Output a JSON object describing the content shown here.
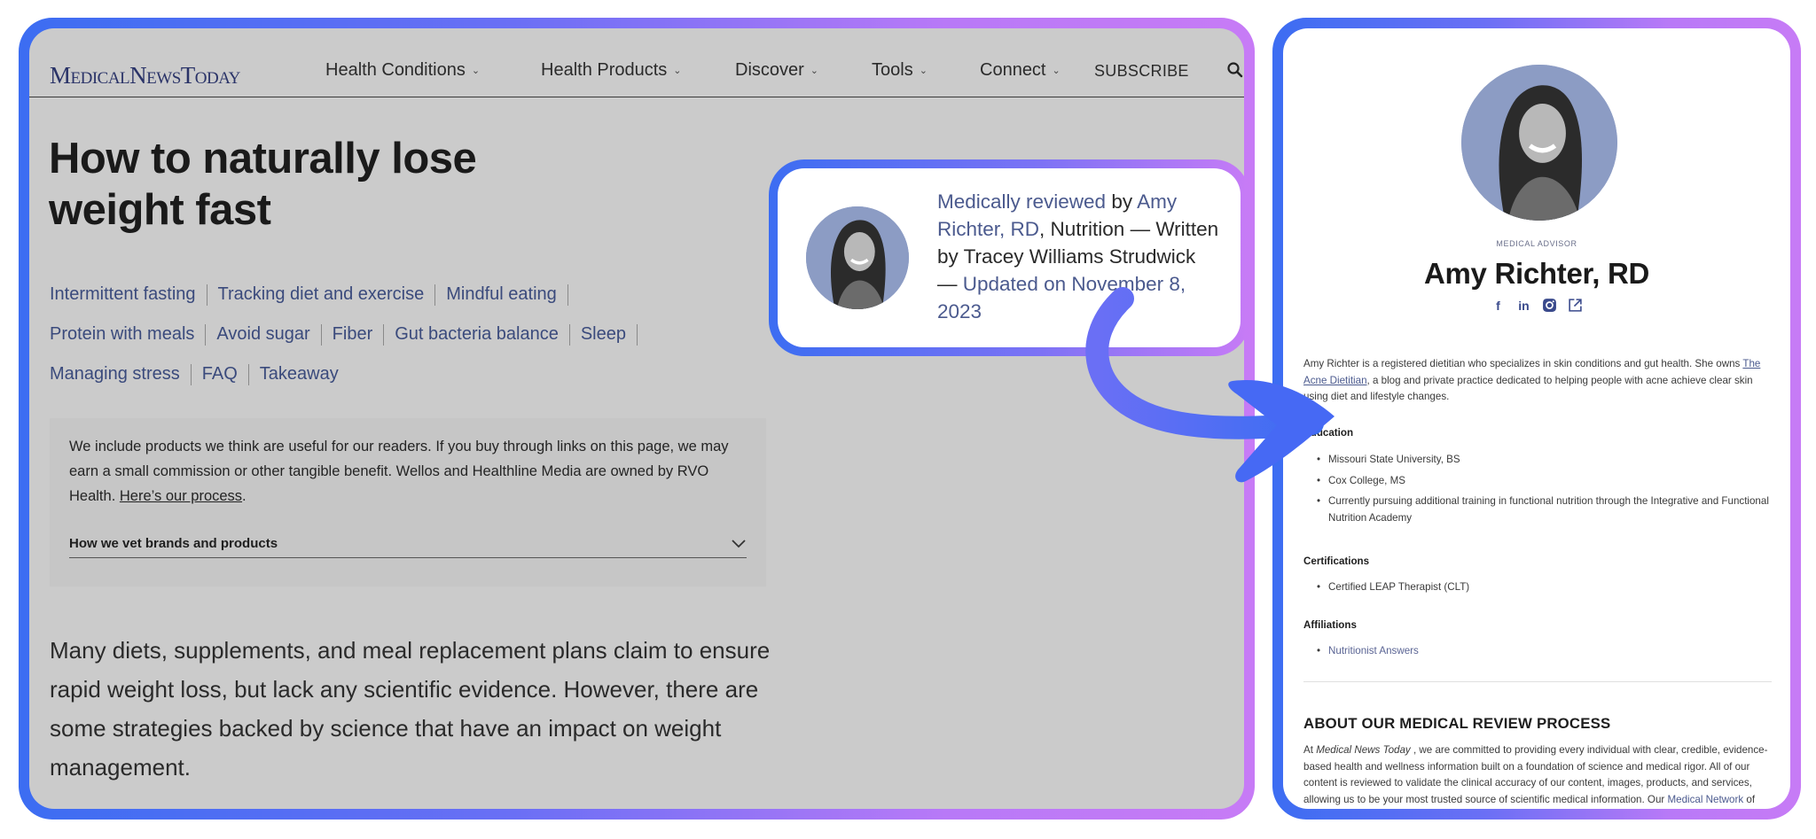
{
  "colors": {
    "frame_gradient_start": "#3c6df2",
    "frame_gradient_end": "#c77bf6",
    "link": "#3a4a7c",
    "arrow": "#4e6cf5"
  },
  "nav": {
    "logo": "MedicalNewsToday",
    "items": [
      {
        "label": "Health Conditions",
        "icon": "chevron-down-icon"
      },
      {
        "label": "Health Products",
        "icon": "chevron-down-icon"
      },
      {
        "label": "Discover",
        "icon": "chevron-down-icon"
      },
      {
        "label": "Tools",
        "icon": "chevron-down-icon"
      },
      {
        "label": "Connect",
        "icon": "chevron-down-icon"
      }
    ],
    "subscribe": "SUBSCRIBE",
    "search_icon": "search-icon"
  },
  "article": {
    "title": "How to naturally lose weight fast",
    "toc": [
      [
        "Intermittent fasting",
        "Tracking diet and exercise",
        "Mindful eating"
      ],
      [
        "Protein with meals",
        "Avoid sugar",
        "Fiber",
        "Gut bacteria balance",
        "Sleep"
      ],
      [
        "Managing stress",
        "FAQ",
        "Takeaway"
      ]
    ],
    "disclosure": {
      "text": "We include products we think are useful for our readers. If you buy through links on this page, we may earn a small commission or other tangible benefit. Wellos and Healthline Media are owned by RVO Health.",
      "link": "Here’s our process",
      "suffix": ".",
      "accordion_label": "How we vet brands and products"
    },
    "intro": "Many diets, supplements, and meal replacement plans claim to ensure rapid weight loss, but lack any scientific evidence. However, there are some strategies backed by science that have an impact on weight management."
  },
  "byline": {
    "reviewed_label": "Medically reviewed",
    "by": " by ",
    "reviewer": "Amy Richter, RD",
    "specialty": ", Nutrition — Written by Tracey Williams Strudwick — ",
    "updated": "Updated on November 8, 2023"
  },
  "profile": {
    "role": "MEDICAL ADVISOR",
    "name": "Amy Richter, RD",
    "socials": [
      "facebook-icon",
      "linkedin-icon",
      "instagram-icon",
      "external-link-icon"
    ],
    "bio_pre": "Amy Richter is a registered dietitian who specializes in skin conditions and gut health. She owns ",
    "bio_link": "The Acne Dietitian",
    "bio_post": ", a blog and private practice dedicated to helping people with acne achieve clear skin using diet and lifestyle changes.",
    "education_heading": "Education",
    "education": [
      "Missouri State University, BS",
      "Cox College, MS",
      "Currently pursuing additional training in functional nutrition through the Integrative and Functional Nutrition Academy"
    ],
    "certifications_heading": "Certifications",
    "certifications": [
      "Certified LEAP Therapist (CLT)"
    ],
    "affiliations_heading": "Affiliations",
    "affiliations": [
      "Nutritionist Answers"
    ],
    "about_heading": "ABOUT OUR MEDICAL REVIEW PROCESS",
    "about_pre": "At ",
    "about_em": "Medical News Today",
    "about_mid": " , we are committed to providing every individual with clear, credible, evidence-based health and wellness information built on a foundation of science and medical rigor. All of our content is reviewed to validate the clinical accuracy of our content, images, products, and services, allowing us to be your most trusted source of scientific medical information. Our ",
    "about_link": "Medical Network",
    "about_post": " of clinical experts carries out our medical reviews. The"
  }
}
